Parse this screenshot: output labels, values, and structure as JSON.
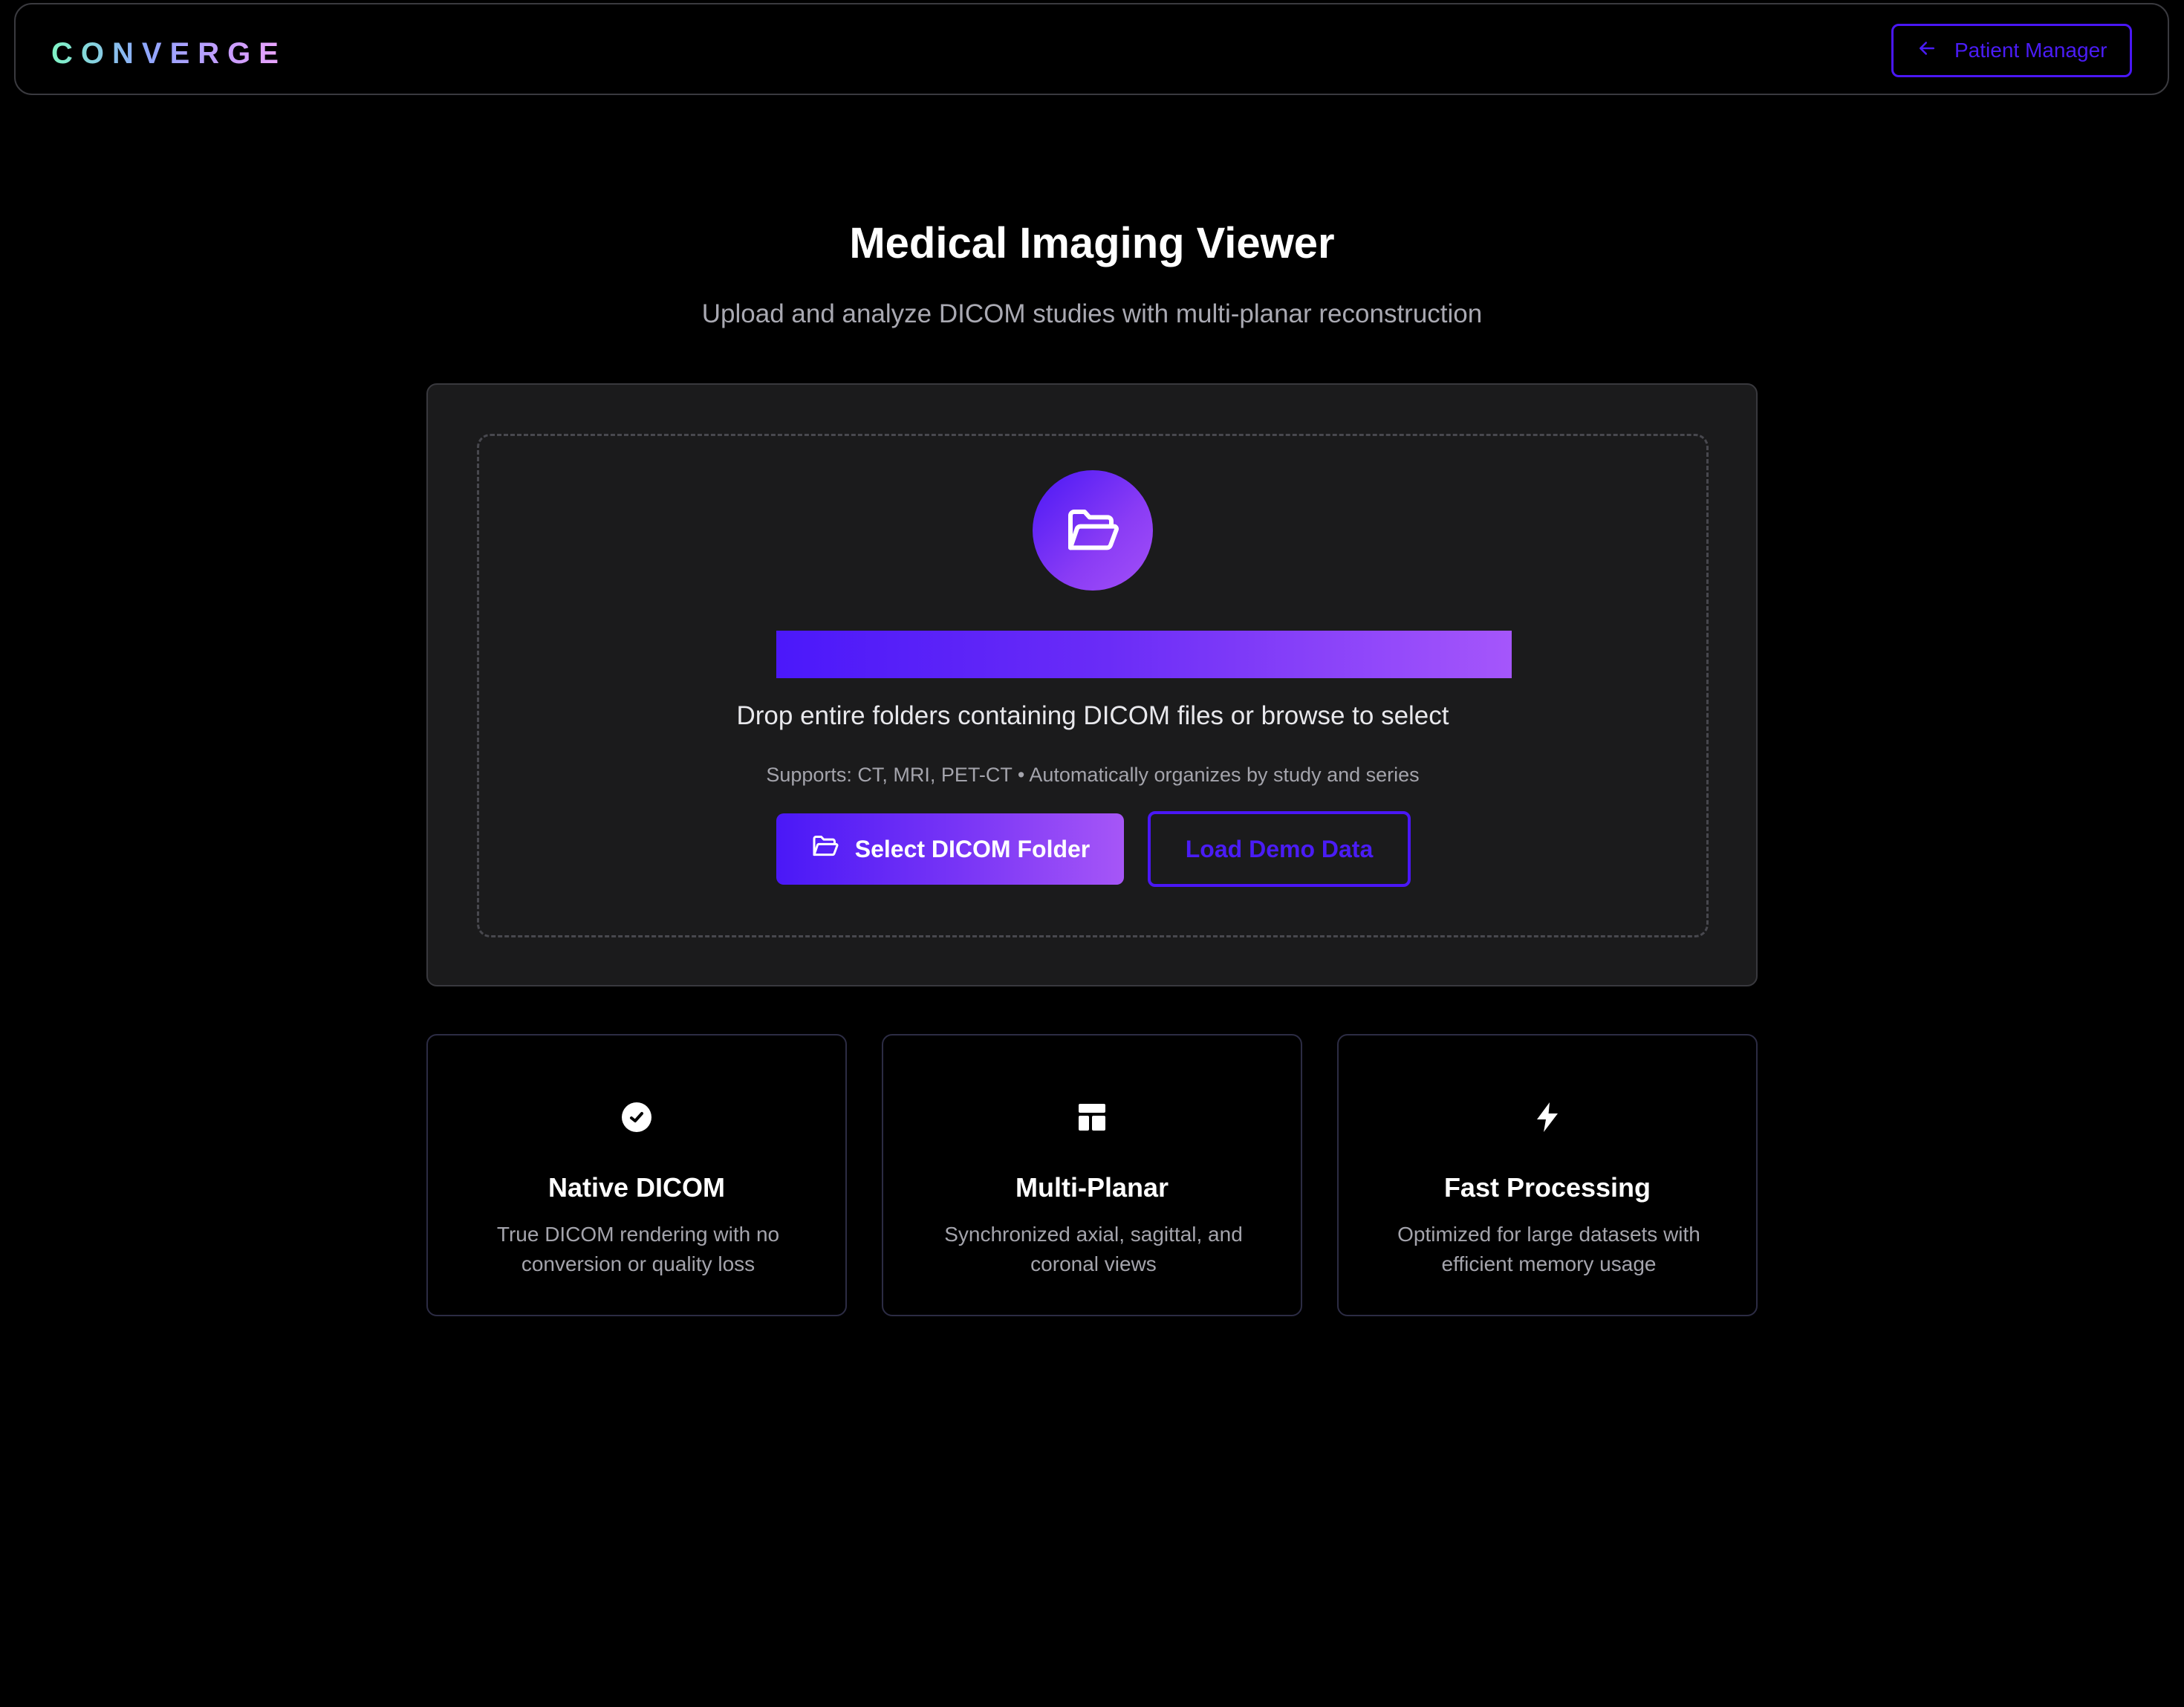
{
  "header": {
    "logo_text": "CONVERGE",
    "back_button_label": "Patient Manager",
    "back_icon": "arrow-left-icon"
  },
  "hero": {
    "title": "Medical Imaging Viewer",
    "subtitle": "Upload and analyze DICOM studies with multi-planar reconstruction"
  },
  "upload": {
    "icon": "folder-open-icon",
    "progress_fraction": 1.0,
    "drop_text": "Drop entire folders containing DICOM files or browse to select",
    "supports_text": "Supports: CT, MRI, PET-CT • Automatically organizes by study and series",
    "select_button_label": "Select DICOM Folder",
    "demo_button_label": "Load Demo Data"
  },
  "features": [
    {
      "icon": "badge-check-icon",
      "title": "Native DICOM",
      "description": "True DICOM rendering with no conversion or quality loss"
    },
    {
      "icon": "layout-icon",
      "title": "Multi-Planar",
      "description": "Synchronized axial, sagittal, and coronal views"
    },
    {
      "icon": "lightning-icon",
      "title": "Fast Processing",
      "description": "Optimized for large datasets with efficient memory usage"
    }
  ],
  "colors": {
    "background": "#000000",
    "accent": "#4a17f5",
    "accent_gradient_end": "#a656f7",
    "card_background": "#1b1b1c",
    "muted_text": "#a4a4ac"
  }
}
